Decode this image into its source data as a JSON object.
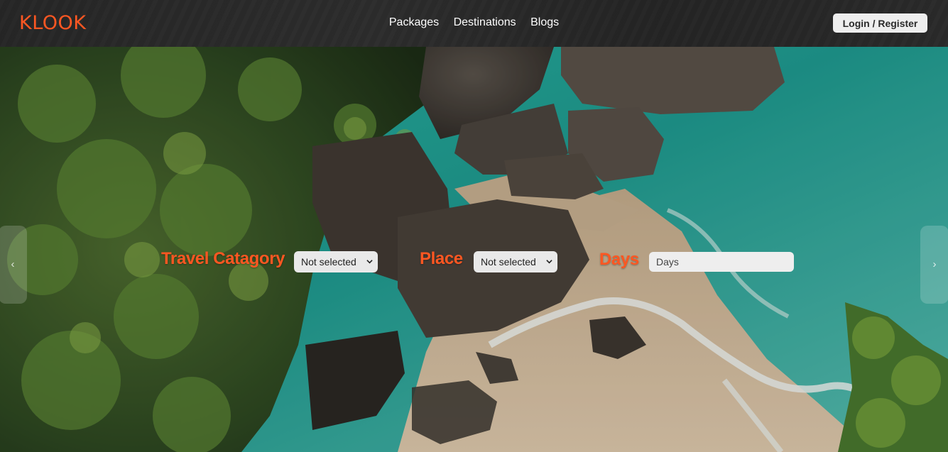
{
  "brand": {
    "logo_text": "KLOOK",
    "accent_color": "#ff5722"
  },
  "nav": {
    "links": [
      "Packages",
      "Destinations",
      "Blogs"
    ],
    "login_label": "Login / Register"
  },
  "search": {
    "category": {
      "label": "Travel Catagory",
      "selected": "Not selected"
    },
    "place": {
      "label": "Place",
      "selected": "Not selected"
    },
    "days": {
      "label": "Days",
      "placeholder": "Days"
    }
  },
  "carousel": {
    "prev_icon": "chevron-left-icon",
    "next_icon": "chevron-right-icon",
    "prev_glyph": "‹",
    "next_glyph": "›"
  },
  "hero": {
    "description_colors": {
      "sea": "#1fa99a",
      "sand": "#d9c2a3",
      "foliage": "#3c5a28",
      "rock": "#4a433d"
    }
  }
}
